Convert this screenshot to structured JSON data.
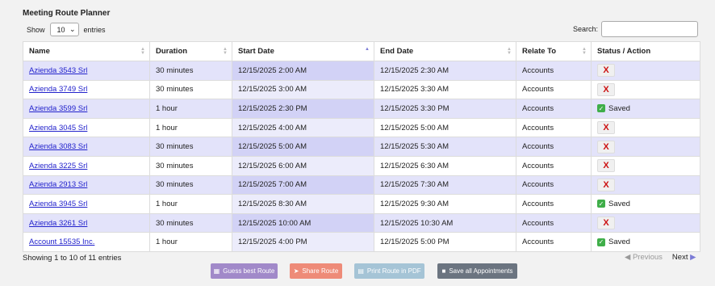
{
  "title": "Meeting Route Planner",
  "show": {
    "prefix": "Show",
    "value": "10",
    "suffix": "entries"
  },
  "search": {
    "label": "Search:",
    "value": ""
  },
  "columns": [
    "Name",
    "Duration",
    "Start Date",
    "End Date",
    "Relate To",
    "Status / Action"
  ],
  "rows": [
    {
      "name": "Azienda 3543 Srl",
      "duration": "30 minutes",
      "start": "12/15/2025 2:00 AM",
      "end": "12/15/2025 2:30 AM",
      "relate": "Accounts",
      "status": "X"
    },
    {
      "name": "Azienda 3749 Srl",
      "duration": "30 minutes",
      "start": "12/15/2025 3:00 AM",
      "end": "12/15/2025 3:30 AM",
      "relate": "Accounts",
      "status": "X"
    },
    {
      "name": "Azienda 3599 Srl",
      "duration": "1 hour",
      "start": "12/15/2025 2:30 PM",
      "end": "12/15/2025 3:30 PM",
      "relate": "Accounts",
      "status": "Saved"
    },
    {
      "name": "Azienda 3045 Srl",
      "duration": "1 hour",
      "start": "12/15/2025 4:00 AM",
      "end": "12/15/2025 5:00 AM",
      "relate": "Accounts",
      "status": "X"
    },
    {
      "name": "Azienda 3083 Srl",
      "duration": "30 minutes",
      "start": "12/15/2025 5:00 AM",
      "end": "12/15/2025 5:30 AM",
      "relate": "Accounts",
      "status": "X"
    },
    {
      "name": "Azienda 3225 Srl",
      "duration": "30 minutes",
      "start": "12/15/2025 6:00 AM",
      "end": "12/15/2025 6:30 AM",
      "relate": "Accounts",
      "status": "X"
    },
    {
      "name": "Azienda 2913 Srl",
      "duration": "30 minutes",
      "start": "12/15/2025 7:00 AM",
      "end": "12/15/2025 7:30 AM",
      "relate": "Accounts",
      "status": "X"
    },
    {
      "name": "Azienda 3945 Srl",
      "duration": "1 hour",
      "start": "12/15/2025 8:30 AM",
      "end": "12/15/2025 9:30 AM",
      "relate": "Accounts",
      "status": "Saved"
    },
    {
      "name": "Azienda 3261 Srl",
      "duration": "30 minutes",
      "start": "12/15/2025 10:00 AM",
      "end": "12/15/2025 10:30 AM",
      "relate": "Accounts",
      "status": "X"
    },
    {
      "name": "Account 15535 Inc.",
      "duration": "1 hour",
      "start": "12/15/2025 4:00 PM",
      "end": "12/15/2025 5:00 PM",
      "relate": "Accounts",
      "status": "Saved"
    }
  ],
  "info": "Showing 1 to 10 of 11 entries",
  "pager": {
    "previous": "Previous",
    "next": "Next"
  },
  "buttons": {
    "guess": "Guess best Route",
    "share": "Share Route",
    "print": "Print Route in PDF",
    "save_all": "Save all Appointments"
  }
}
